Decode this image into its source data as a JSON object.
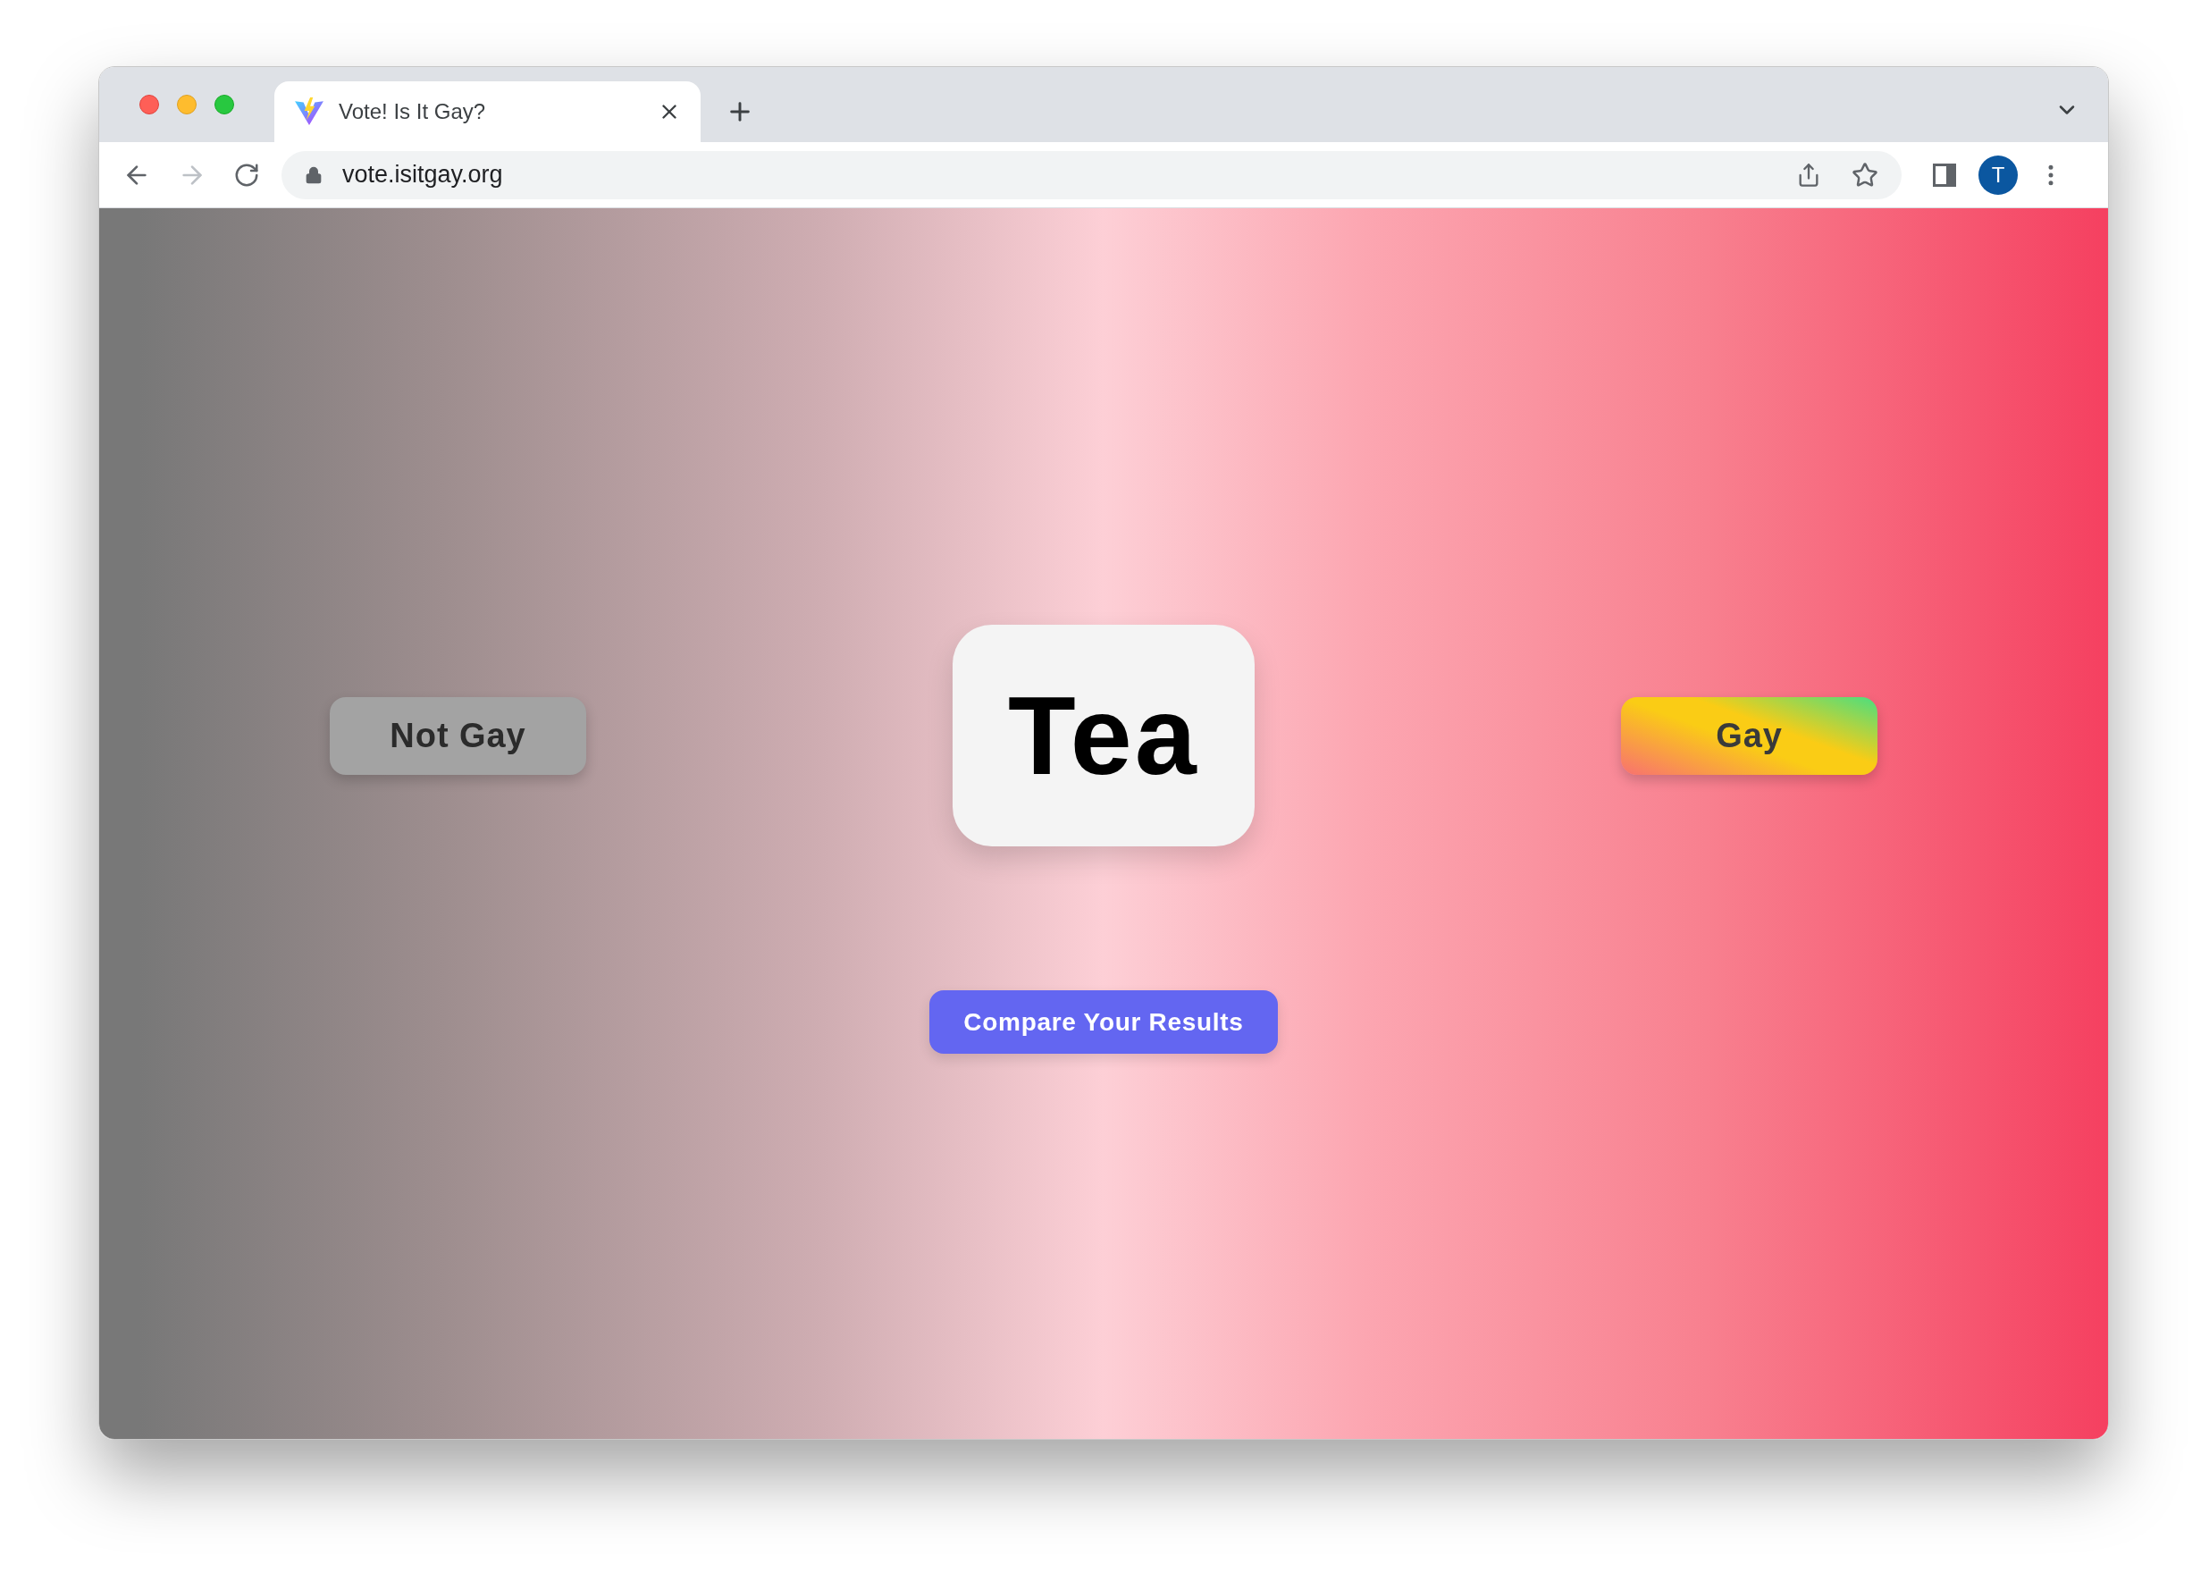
{
  "browser": {
    "tab": {
      "title": "Vote! Is It Gay?",
      "selected": true
    },
    "url": "vote.isitgay.org",
    "profile_initial": "T"
  },
  "page": {
    "word": "Tea",
    "vote_buttons": [
      {
        "label": "Not Gay",
        "kind": "plain"
      },
      {
        "label": "Gay",
        "kind": "rainbow"
      }
    ],
    "compare_button": "Compare Your Results"
  }
}
